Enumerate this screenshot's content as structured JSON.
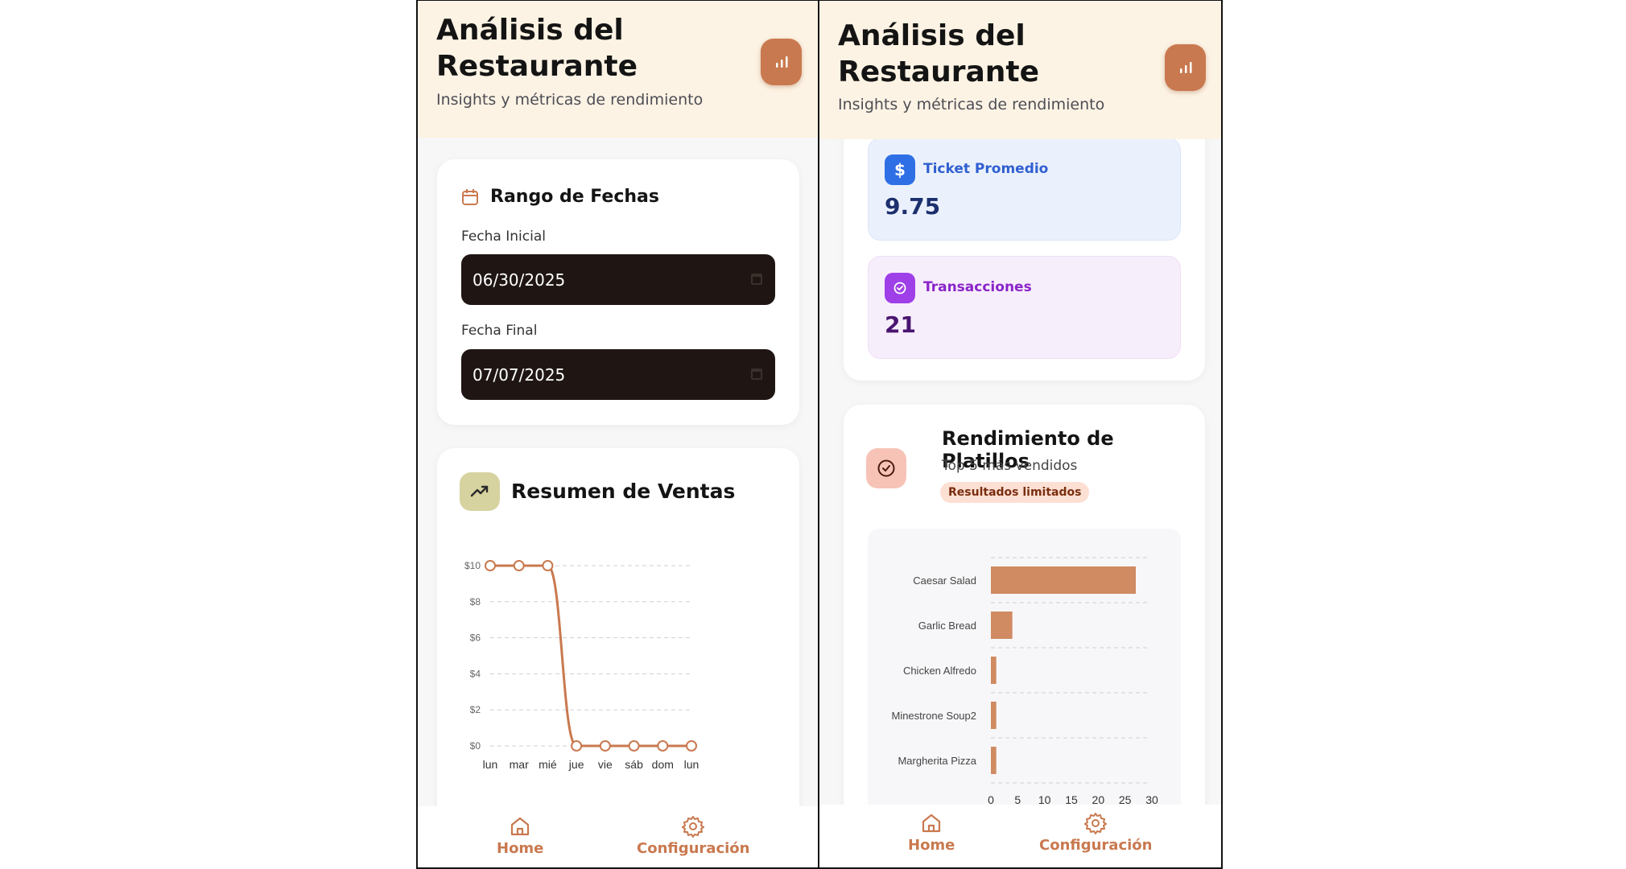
{
  "header": {
    "title_line1": "Análisis del",
    "title_line2": "Restaurante",
    "subtitle": "Insights y métricas de rendimiento",
    "icon": "bar-chart-icon"
  },
  "date_range": {
    "title": "Rango de Fechas",
    "start_label": "Fecha Inicial",
    "start_value": "06/30/2025",
    "end_label": "Fecha Final",
    "end_value": "07/07/2025"
  },
  "sales_summary": {
    "title": "Resumen de Ventas"
  },
  "stats": {
    "avg_ticket_label": "Ticket Promedio",
    "avg_ticket_value": "9.75",
    "transactions_label": "Transacciones",
    "transactions_value": "21"
  },
  "dishes": {
    "title": "Rendimiento de Platillos",
    "subtitle": "Top 5 más vendidos",
    "badge": "Resultados limitados"
  },
  "nav": {
    "home": "Home",
    "settings": "Configuración"
  },
  "colors": {
    "accent": "#c9794f",
    "header_bg": "#fdf3e4",
    "blue": "#2f6fe6",
    "purple": "#9f3fe8"
  },
  "chart_data": [
    {
      "type": "line",
      "x": [
        "lun",
        "mar",
        "mié",
        "jue",
        "vie",
        "sáb",
        "dom",
        "lun"
      ],
      "values": [
        10,
        10,
        10,
        0,
        0,
        0,
        0,
        0
      ],
      "ylim": [
        0,
        10
      ],
      "yticks": [
        0,
        2,
        4,
        6,
        8,
        10
      ],
      "ytick_labels": [
        "$0",
        "$2",
        "$4",
        "$6",
        "$8",
        "$10"
      ],
      "grid": true
    },
    {
      "type": "bar",
      "orientation": "horizontal",
      "categories": [
        "Caesar Salad",
        "Garlic Bread",
        "Chicken Alfredo",
        "Minestrone Soup2",
        "Margherita Pizza"
      ],
      "values": [
        27,
        4,
        1,
        1,
        1
      ],
      "xlim": [
        0,
        30
      ],
      "xticks": [
        0,
        5,
        10,
        15,
        20,
        25,
        30
      ],
      "grid": true
    }
  ]
}
